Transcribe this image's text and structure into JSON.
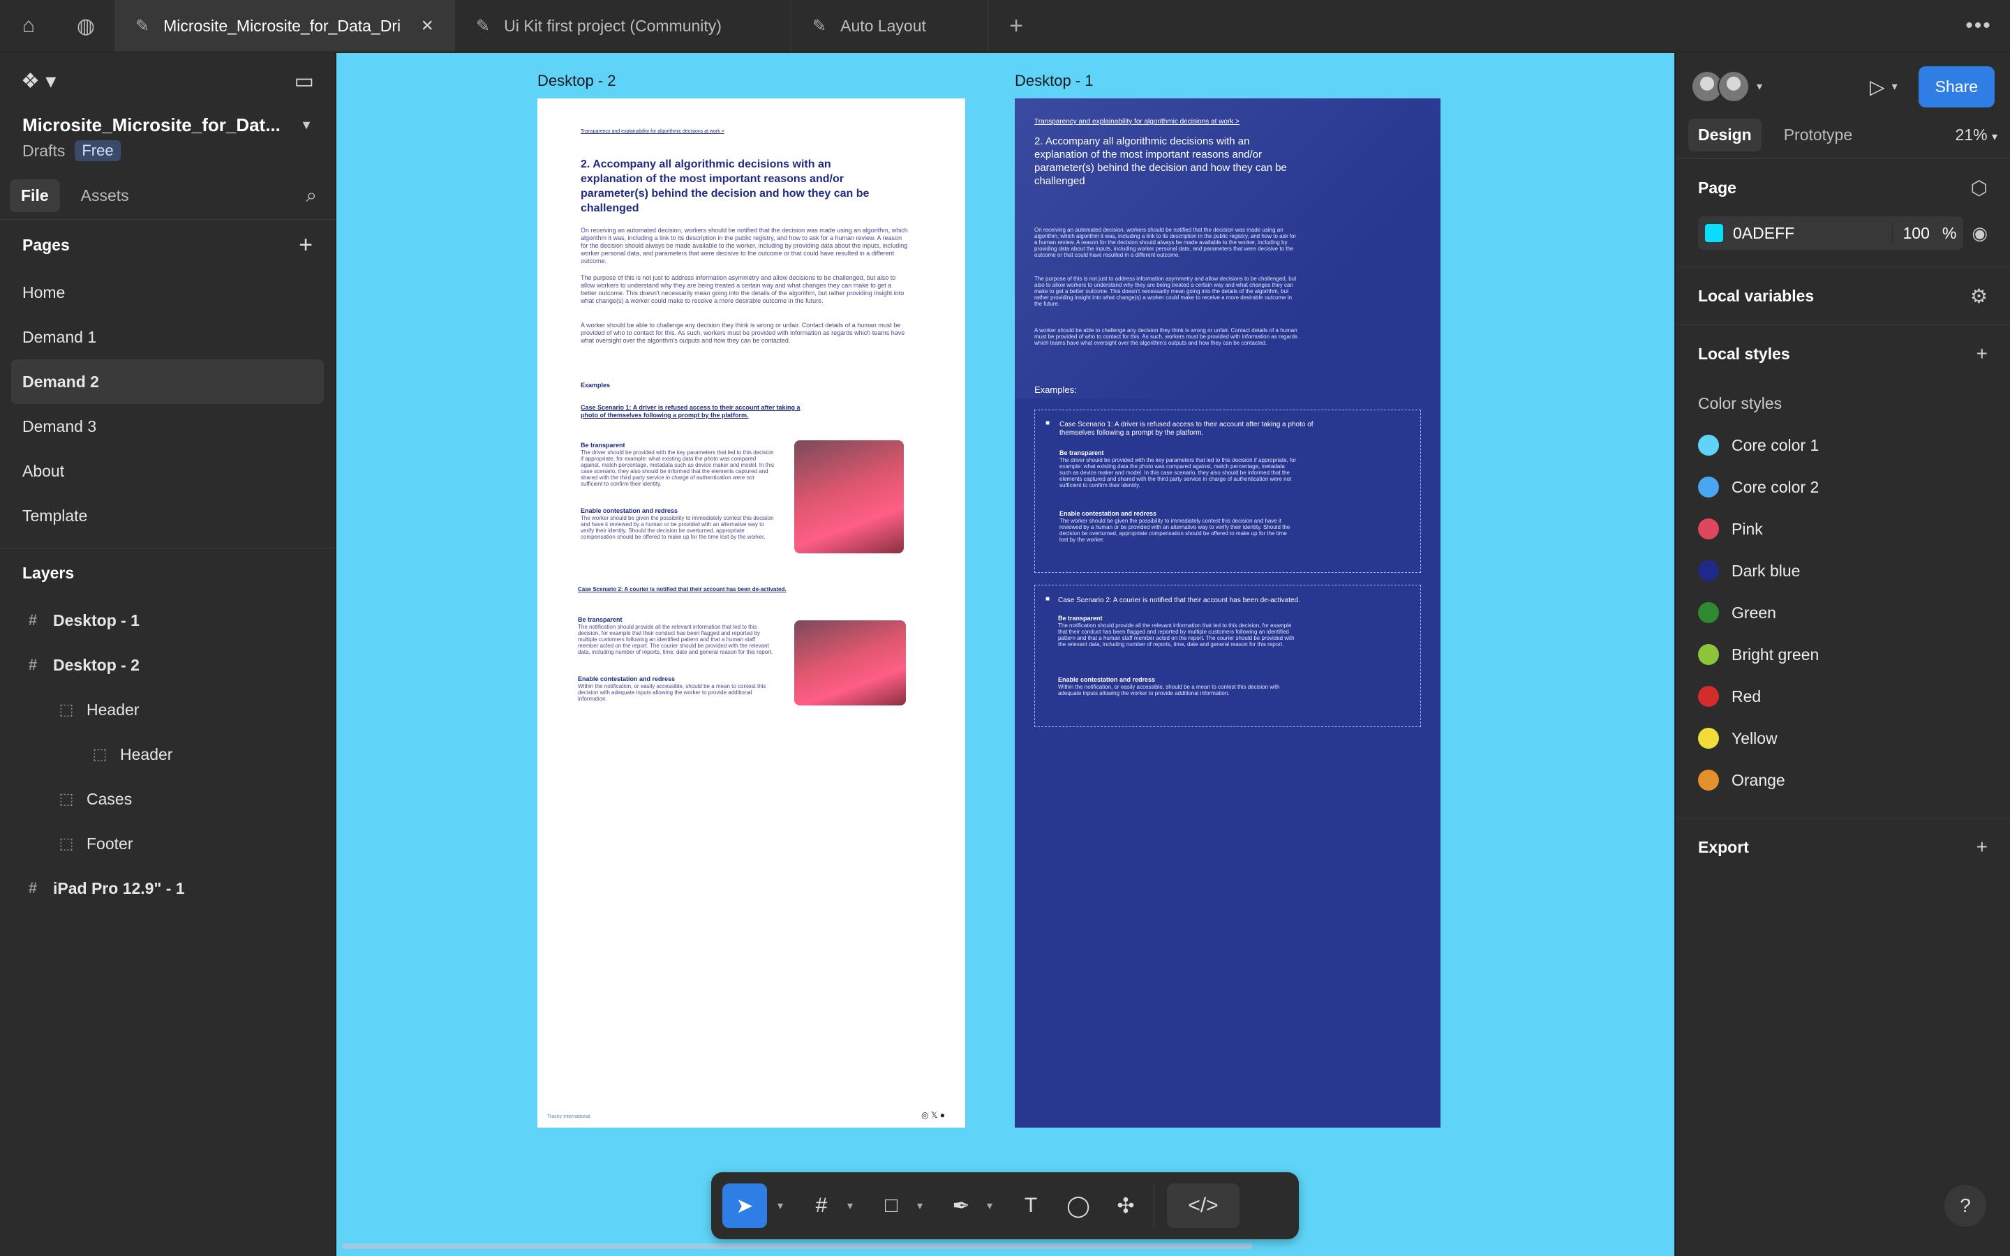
{
  "tabs": [
    {
      "label": "Microsite_Microsite_for_Data_Dri"
    },
    {
      "label": "Ui Kit first project (Community)"
    },
    {
      "label": "Auto Layout"
    }
  ],
  "left": {
    "file_title": "Microsite_Microsite_for_Dat...",
    "location": "Drafts",
    "plan_badge": "Free",
    "file_tab": "File",
    "assets_tab": "Assets",
    "pages_heading": "Pages",
    "pages": [
      "Home",
      "Demand 1",
      "Demand 2",
      "Demand 3",
      "About",
      "Template"
    ],
    "layers_heading": "Layers",
    "layers": [
      "Desktop - 1",
      "Desktop - 2",
      "Header",
      "Header",
      "Cases",
      "Footer",
      "iPad Pro 12.9\" - 1"
    ]
  },
  "canvas": {
    "frame_a_label": "Desktop - 2",
    "frame_b_label": "Desktop - 1",
    "breadcrumb": "Transparency and explainability for algorithmic decisions at work >",
    "heading_a": "2. Accompany all algorithmic decisions with an explanation of the most important reasons and/or parameter(s) behind the decision and how they can be challenged",
    "heading_b": "2. Accompany all algorithmic decisions with an explanation of the most important reasons and/or parameter(s) behind the decision and how they can be challenged",
    "para1": "On receiving an automated decision, workers should be notified that the decision was made using an algorithm, which algorithm it was, including a link to its description in the public registry, and how to ask for a human review. A reason for the decision should always be made available to the worker, including by providing data about the inputs, including worker personal data, and parameters that were decisive to the outcome or that could have resulted in a different outcome.",
    "para2": "The purpose of this is not just to address information asymmetry and allow decisions to be challenged, but also to allow workers to understand why they are being treated a certain way and what changes they can make to get a better outcome. This doesn't necessarily mean going into the details of the algorithm, but rather providing insight into what change(s) a worker could make to receive a more desirable outcome in the future.",
    "para3": "A worker should be able to challenge any decision they think is wrong or unfair. Contact details of a human must be provided of who to contact for this. As such, workers must be provided with information as regards which teams have what oversight over the algorithm's outputs and how they can be contacted.",
    "examples_a": "Examples",
    "examples_b": "Examples:",
    "case1": "Case Scenario 1: A driver is refused access to their account after taking a photo of themselves following a prompt by the platform.",
    "case1_t1": "Be transparent",
    "case1_p1": "The driver should be provided with the key parameters that led to this decision if appropriate, for example: what existing data the photo was compared against, match percentage, metadata such as device maker and model. In this case scenario, they also should be informed that the elements captured and shared with the third party service in charge of authentication were not sufficient to confirm their identity.",
    "case1_t2": "Enable contestation and redress",
    "case1_p2": "The worker should be given the possibility to immediately contest this decision and have it reviewed by a human or be provided with an alternative way to verify their identity. Should the decision be overturned, appropriate compensation should be offered to make up for the time lost by the worker.",
    "case2": "Case Scenario 2: A courier is notified that their account has been de-activated.",
    "case2_t1": "Be transparent",
    "case2_p1": "The notification should provide all the relevant information that led to this decision, for example that their conduct has been flagged and reported by multiple customers following an identified pattern and that a human staff member acted on the report. The courier should be provided with the relevant data, including number of reports, time, date and general reason for this report.",
    "case2_t2": "Enable contestation and redress",
    "case2_p2": "Within the notification, or easily accessible, should be a mean to contest this decision with adequate inputs allowing the worker to provide additional information.",
    "footer_logo": "Tracey International",
    "footer_icons": "◎ 𝕏 ●"
  },
  "toolbar": {
    "move": "➤",
    "frame": "#",
    "rect": "□",
    "pen": "✒",
    "text": "T",
    "comment": "◯",
    "resources": "✣",
    "dev": "</>"
  },
  "right": {
    "play": "▷",
    "share": "Share",
    "design_tab": "Design",
    "prototype_tab": "Prototype",
    "zoom": "21%",
    "page_heading": "Page",
    "page_color": "0ADEFF",
    "page_opacity": "100",
    "percent": "%",
    "local_variables": "Local variables",
    "local_styles": "Local styles",
    "color_styles": "Color styles",
    "colors": [
      {
        "name": "Core color 1",
        "hex": "#5fd4f8"
      },
      {
        "name": "Core color 2",
        "hex": "#4aa6f0"
      },
      {
        "name": "Pink",
        "hex": "#e0465e"
      },
      {
        "name": "Dark blue",
        "hex": "#1f2a88"
      },
      {
        "name": "Green",
        "hex": "#2e8a30"
      },
      {
        "name": "Bright green",
        "hex": "#8dc43a"
      },
      {
        "name": "Red",
        "hex": "#d42c2c"
      },
      {
        "name": "Yellow",
        "hex": "#f2dd38"
      },
      {
        "name": "Orange",
        "hex": "#e3912c"
      }
    ],
    "export": "Export",
    "help": "?"
  }
}
